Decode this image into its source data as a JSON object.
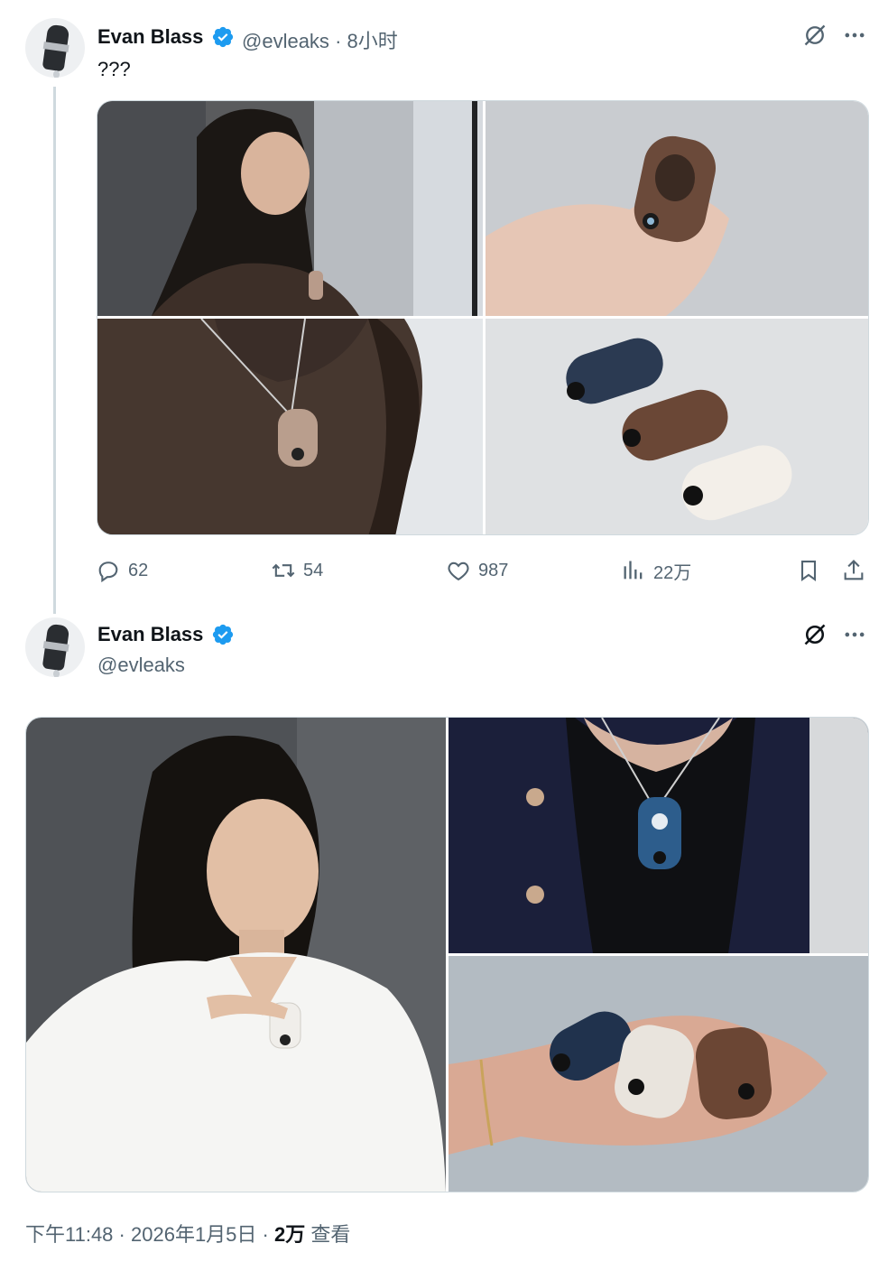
{
  "tweet1": {
    "name": "Evan Blass",
    "handle": "@evleaks",
    "separator": "·",
    "time": "8小时",
    "text": "???",
    "actions": {
      "reply_count": "62",
      "retweet_count": "54",
      "like_count": "987",
      "views_count": "22万"
    }
  },
  "tweet2": {
    "name": "Evan Blass",
    "handle": "@evleaks",
    "meta": {
      "time": "下午11:48",
      "sep1": "·",
      "date": "2026年1月5日",
      "sep2": "·",
      "views": "2万",
      "views_label": "查看"
    }
  },
  "colors": {
    "verified": "#1d9bf0",
    "text_primary": "#0f1419",
    "text_secondary": "#536471",
    "border": "#cfd9de"
  },
  "icons": [
    "grok-icon",
    "more-icon",
    "reply-icon",
    "retweet-icon",
    "like-icon",
    "views-icon",
    "bookmark-icon",
    "share-icon",
    "verified-icon"
  ]
}
